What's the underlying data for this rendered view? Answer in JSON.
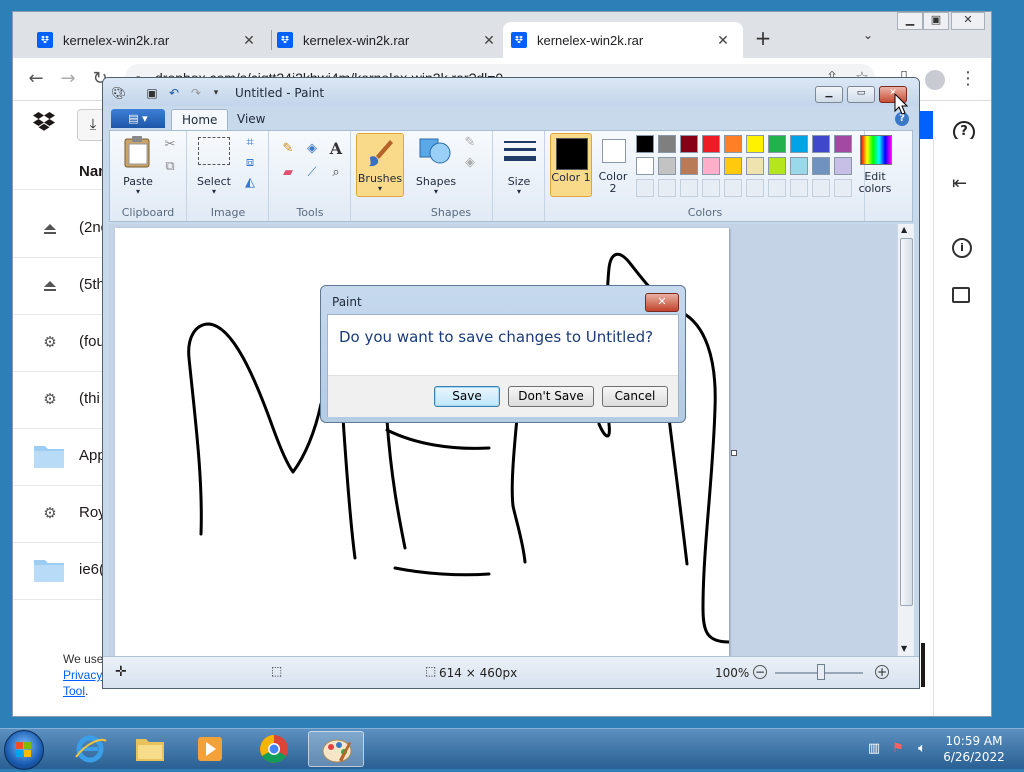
{
  "browser": {
    "tabs": [
      {
        "title": "kernelex-win2k.rar"
      },
      {
        "title": "kernelex-win2k.rar"
      },
      {
        "title": "kernelex-win2k.rar"
      }
    ],
    "url": "dropbox.com/s/cjqtt24i2khwi4m/kernelex-win2k.rar?dl=0"
  },
  "dropbox": {
    "name_header": "Nan",
    "rows": [
      {
        "name": "(2nd",
        "icon": "eject-icon"
      },
      {
        "name": "(5th",
        "icon": "eject-icon"
      },
      {
        "name": "(fou",
        "icon": "gear-icon"
      },
      {
        "name": "(thi",
        "icon": "gear-icon"
      },
      {
        "name": "App",
        "icon": "folder-icon"
      },
      {
        "name": "Roy",
        "icon": "gear-icon"
      },
      {
        "name": "ie6(",
        "icon": "folder-icon"
      }
    ],
    "cookie_text": "We use",
    "cookie_link1": "Privacy",
    "cookie_link2": "Tool",
    "help_label": "?"
  },
  "paint": {
    "title": "Untitled - Paint",
    "tabs": [
      "Home",
      "View"
    ],
    "groups": {
      "clipboard": "Clipboard",
      "image": "Image",
      "tools": "Tools",
      "shapes": "Shapes",
      "colors": "Colors"
    },
    "labels": {
      "paste": "Paste",
      "select": "Select",
      "brushes": "Brushes",
      "shapes": "Shapes",
      "size": "Size",
      "color1": "Color 1",
      "color2": "Color 2",
      "edit_colors": "Edit colors"
    },
    "palette_row1": [
      "#000000",
      "#7f7f7f",
      "#880015",
      "#ed1c24",
      "#ff7f27",
      "#fff200",
      "#22b14c",
      "#00a2e8",
      "#3f48cc",
      "#a349a4"
    ],
    "palette_row2": [
      "#ffffff",
      "#c3c3c3",
      "#b97a57",
      "#ffaec9",
      "#ffc90e",
      "#efe4b0",
      "#b5e61d",
      "#99d9ea",
      "#7092be",
      "#c8bfe7"
    ],
    "canvas_size": "614 × 460px",
    "zoom": "100%"
  },
  "dialog": {
    "title": "Paint",
    "message": "Do you want to save changes to Untitled?",
    "save": "Save",
    "dont_save": "Don't Save",
    "cancel": "Cancel"
  },
  "taskbar": {
    "time": "10:59 AM",
    "date": "6/26/2022"
  }
}
